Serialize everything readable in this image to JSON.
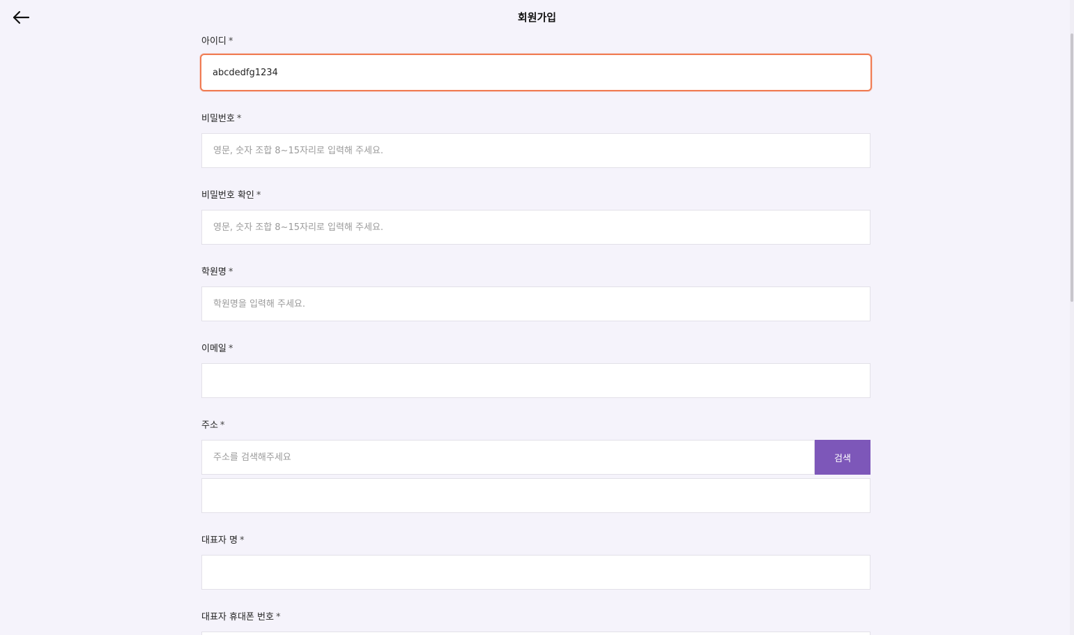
{
  "header": {
    "title": "회원가입",
    "back_icon": "arrow-left-icon"
  },
  "form": {
    "user_id": {
      "label": "아이디",
      "required": "*",
      "value": "abcdedfg1234"
    },
    "password": {
      "label": "비밀번호",
      "required": "*",
      "placeholder": "영문, 숫자 조합 8~15자리로 입력해 주세요."
    },
    "password_confirm": {
      "label": "비밀번호 확인",
      "required": "*",
      "placeholder": "영문, 숫자 조합 8~15자리로 입력해 주세요."
    },
    "academy_name": {
      "label": "학원명",
      "required": "*",
      "placeholder": "학원명을 입력해 주세요."
    },
    "email": {
      "label": "이메일",
      "required": "*",
      "placeholder": ""
    },
    "address": {
      "label": "주소",
      "required": "*",
      "placeholder": "주소를 검색해주세요",
      "search_label": "검색",
      "detail_placeholder": ""
    },
    "representative_name": {
      "label": "대표자 명",
      "required": "*",
      "placeholder": ""
    },
    "representative_phone": {
      "label": "대표자 휴대폰 번호",
      "required": "*"
    }
  },
  "colors": {
    "background": "#f5f3fb",
    "accent": "#7d57b9",
    "focus_border": "#f07b52"
  }
}
